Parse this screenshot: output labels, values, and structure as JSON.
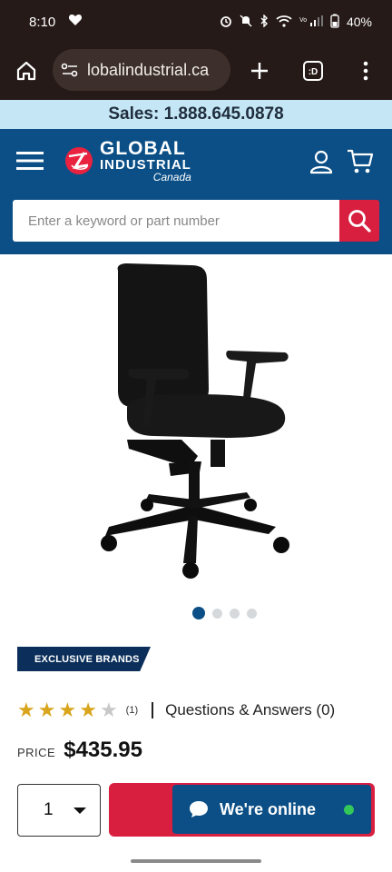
{
  "status_bar": {
    "time": "8:10",
    "battery": "40%"
  },
  "browser": {
    "url": "lobalindustrial.ca"
  },
  "sales_banner": {
    "text": "Sales: 1.888.645.0878"
  },
  "header": {
    "logo_line1": "GLOBAL",
    "logo_line2": "INDUSTRIAL",
    "logo_line3": "Canada",
    "search_placeholder": "Enter a keyword or part number"
  },
  "product": {
    "badge": "EXCLUSIVE BRANDS",
    "rating": 4,
    "rating_max": 5,
    "rating_count": "(1)",
    "qa_link": "Questions & Answers (0)",
    "price_label": "PRICE",
    "price": "$435.95",
    "quantity": "1",
    "gallery_dots": 4,
    "gallery_active": 1
  },
  "chat": {
    "label": "We're online"
  },
  "colors": {
    "brand_blue": "#0b4f86",
    "brand_red": "#d81f3f",
    "banner_blue": "#c5e7f5",
    "star_gold": "#d8a51c"
  }
}
